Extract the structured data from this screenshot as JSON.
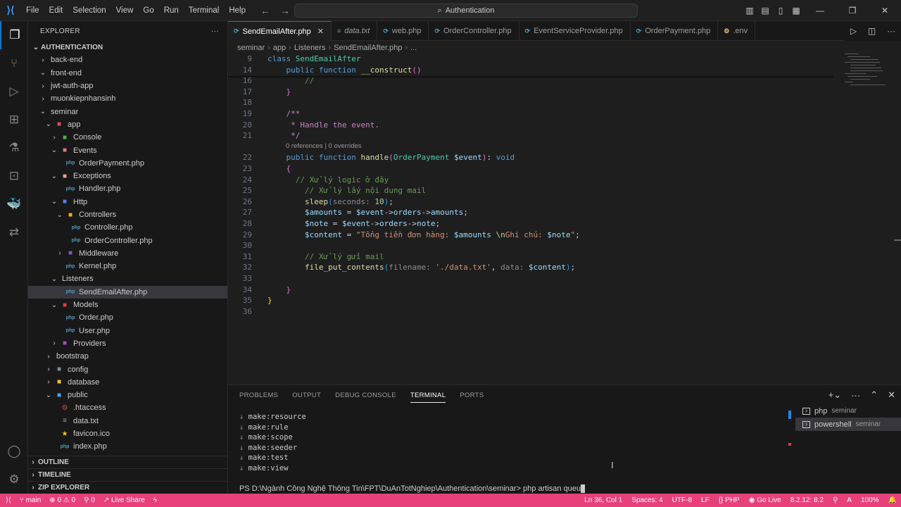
{
  "window": {
    "title": "Authentication",
    "menu": [
      "File",
      "Edit",
      "Selection",
      "View",
      "Go",
      "Run",
      "Terminal",
      "Help"
    ]
  },
  "explorer": {
    "header": "EXPLORER",
    "project": "AUTHENTICATION",
    "tree": [
      {
        "label": "back-end",
        "depth": 0,
        "type": "folder",
        "open": false
      },
      {
        "label": "front-end",
        "depth": 0,
        "type": "folder",
        "open": true
      },
      {
        "label": "jwt-auth-app",
        "depth": 0,
        "type": "folder",
        "open": false
      },
      {
        "label": "muonkiepnhansinh",
        "depth": 0,
        "type": "folder",
        "open": false
      },
      {
        "label": "seminar",
        "depth": 0,
        "type": "folder",
        "open": true
      },
      {
        "label": "app",
        "depth": 1,
        "type": "folder-app",
        "open": true
      },
      {
        "label": "Console",
        "depth": 2,
        "type": "folder-console",
        "open": false
      },
      {
        "label": "Events",
        "depth": 2,
        "type": "folder-events",
        "open": true
      },
      {
        "label": "OrderPayment.php",
        "depth": 3,
        "type": "php"
      },
      {
        "label": "Exceptions",
        "depth": 2,
        "type": "folder-exc",
        "open": true
      },
      {
        "label": "Handler.php",
        "depth": 3,
        "type": "php"
      },
      {
        "label": "Http",
        "depth": 2,
        "type": "folder-http",
        "open": true
      },
      {
        "label": "Controllers",
        "depth": 3,
        "type": "folder-ctrl",
        "open": true
      },
      {
        "label": "Controller.php",
        "depth": 4,
        "type": "php"
      },
      {
        "label": "OrderController.php",
        "depth": 4,
        "type": "php"
      },
      {
        "label": "Middleware",
        "depth": 3,
        "type": "folder-mw",
        "open": false
      },
      {
        "label": "Kernel.php",
        "depth": 3,
        "type": "php"
      },
      {
        "label": "Listeners",
        "depth": 2,
        "type": "folder",
        "open": true
      },
      {
        "label": "SendEmailAfter.php",
        "depth": 3,
        "type": "php",
        "selected": true
      },
      {
        "label": "Models",
        "depth": 2,
        "type": "folder-models",
        "open": true
      },
      {
        "label": "Order.php",
        "depth": 3,
        "type": "php"
      },
      {
        "label": "User.php",
        "depth": 3,
        "type": "php"
      },
      {
        "label": "Providers",
        "depth": 2,
        "type": "folder-prov",
        "open": false
      },
      {
        "label": "bootstrap",
        "depth": 1,
        "type": "folder",
        "open": false
      },
      {
        "label": "config",
        "depth": 1,
        "type": "folder-config",
        "open": false
      },
      {
        "label": "database",
        "depth": 1,
        "type": "folder-db",
        "open": false
      },
      {
        "label": "public",
        "depth": 1,
        "type": "folder-public",
        "open": true
      },
      {
        "label": ".htaccess",
        "depth": 2,
        "type": "htaccess"
      },
      {
        "label": "data.txt",
        "depth": 2,
        "type": "txt"
      },
      {
        "label": "favicon.ico",
        "depth": 2,
        "type": "ico"
      },
      {
        "label": "index.php",
        "depth": 2,
        "type": "php"
      }
    ],
    "sections": [
      "OUTLINE",
      "TIMELINE",
      "ZIP EXPLORER"
    ]
  },
  "tabs": [
    {
      "label": "SendEmailAfter.php",
      "active": true,
      "italic": false
    },
    {
      "label": "data.txt",
      "active": false,
      "italic": true
    },
    {
      "label": "web.php",
      "active": false,
      "italic": false
    },
    {
      "label": "OrderController.php",
      "active": false,
      "italic": false
    },
    {
      "label": "EventServiceProvider.php",
      "active": false,
      "italic": false
    },
    {
      "label": "OrderPayment.php",
      "active": false,
      "italic": false
    },
    {
      "label": ".env",
      "active": false,
      "italic": false
    }
  ],
  "breadcrumb": [
    "seminar",
    "app",
    "Listeners",
    "SendEmailAfter.php",
    "..."
  ],
  "code": {
    "codelens": "0 references | 0 overrides",
    "lines": [
      {
        "n": "9",
        "html": "<span class=\"kw\">class</span> <span class=\"cls\">SendEmailAfter</span>"
      },
      {
        "n": "14",
        "html": "    <span class=\"kw\">public</span> <span class=\"kw\">function</span> <span class=\"fn\">__construct</span><span class=\"br2\">()</span>"
      },
      {
        "n": "16",
        "html": "        <span class=\"cmg\">//</span>"
      },
      {
        "n": "17",
        "html": "    <span class=\"br2\">}</span>"
      },
      {
        "n": "18",
        "html": ""
      },
      {
        "n": "19",
        "html": "    <span class=\"cm\">/**</span>"
      },
      {
        "n": "20",
        "html": "     <span class=\"cm\">* Handle the event.</span>"
      },
      {
        "n": "21",
        "html": "     <span class=\"cm\">*/</span>"
      },
      {
        "n": "22",
        "html": "    <span class=\"kw\">public</span> <span class=\"kw\">function</span> <span class=\"fn\">handle</span><span class=\"br2\">(</span><span class=\"cls\">OrderPayment</span> <span class=\"var\">$event</span><span class=\"br2\">)</span>: <span class=\"kw\">void</span>"
      },
      {
        "n": "23",
        "html": "    <span class=\"br2\">{</span>"
      },
      {
        "n": "24",
        "html": "      <span class=\"cmg\">// Xử lý logic ở đây</span>"
      },
      {
        "n": "25",
        "html": "        <span class=\"cmg\">// Xử lý lấy nội dung mail</span>"
      },
      {
        "n": "26",
        "html": "        <span class=\"fn\">sleep</span><span class=\"br3\">(</span><span class=\"hint\">seconds: </span><span class=\"num\">10</span><span class=\"br3\">)</span>;"
      },
      {
        "n": "27",
        "html": "        <span class=\"var\">$amounts</span> = <span class=\"var\">$event</span>-><span class=\"var\">orders</span>-><span class=\"var\">amounts</span>;"
      },
      {
        "n": "28",
        "html": "        <span class=\"var\">$note</span> = <span class=\"var\">$event</span>-><span class=\"var\">orders</span>-><span class=\"var\">note</span>;"
      },
      {
        "n": "29",
        "html": "        <span class=\"var\">$content</span> = <span class=\"str\">\"Tổng tiền đơn hàng: </span><span class=\"var\">$amounts</span> <span class=\"num\">\\n</span><span class=\"str\">Ghi chú: </span><span class=\"var\">$note</span><span class=\"str\">\"</span>;"
      },
      {
        "n": "30",
        "html": ""
      },
      {
        "n": "31",
        "html": "        <span class=\"cmg\">// Xử lý gửi mail</span>"
      },
      {
        "n": "32",
        "html": "        <span class=\"fn\">file_put_contents</span><span class=\"br3\">(</span><span class=\"hint\">filename: </span><span class=\"str\">'./data.txt'</span>, <span class=\"hint\">data: </span><span class=\"var\">$content</span><span class=\"br3\">)</span>;"
      },
      {
        "n": "33",
        "html": ""
      },
      {
        "n": "34",
        "html": "    <span class=\"br2\">}</span>"
      },
      {
        "n": "35",
        "html": "<span class=\"br1\">}</span>"
      },
      {
        "n": "36",
        "html": ""
      }
    ]
  },
  "panel": {
    "tabs": [
      "PROBLEMS",
      "OUTPUT",
      "DEBUG CONSOLE",
      "TERMINAL",
      "PORTS"
    ],
    "active_tab": "TERMINAL",
    "terminal_lines": [
      "make:resource",
      "make:rule",
      "make:scope",
      "make:seeder",
      "make:test",
      "make:view"
    ],
    "prompt": "PS D:\\Ngành Công Nghệ Thông Tin\\FPT\\DuAnTotNghiep\\Authentication\\seminar> php artisan queu",
    "terminals": [
      {
        "name": "php",
        "sub": "seminar",
        "selected": false
      },
      {
        "name": "powershell",
        "sub": "seminar",
        "selected": true
      }
    ]
  },
  "status": {
    "branch": "main",
    "problems": "0",
    "warnings": "0",
    "ports": "0",
    "live_share": "Live Share",
    "position": "Ln 36, Col 1",
    "spaces": "Spaces: 4",
    "encoding": "UTF-8",
    "eol": "LF",
    "language": "PHP",
    "go_live": "Go Live",
    "php_version": "8.2.12: 8.2",
    "zoom": "100%"
  },
  "colors": {
    "accent": "#0078d4",
    "statusbar": "#e8407a"
  }
}
